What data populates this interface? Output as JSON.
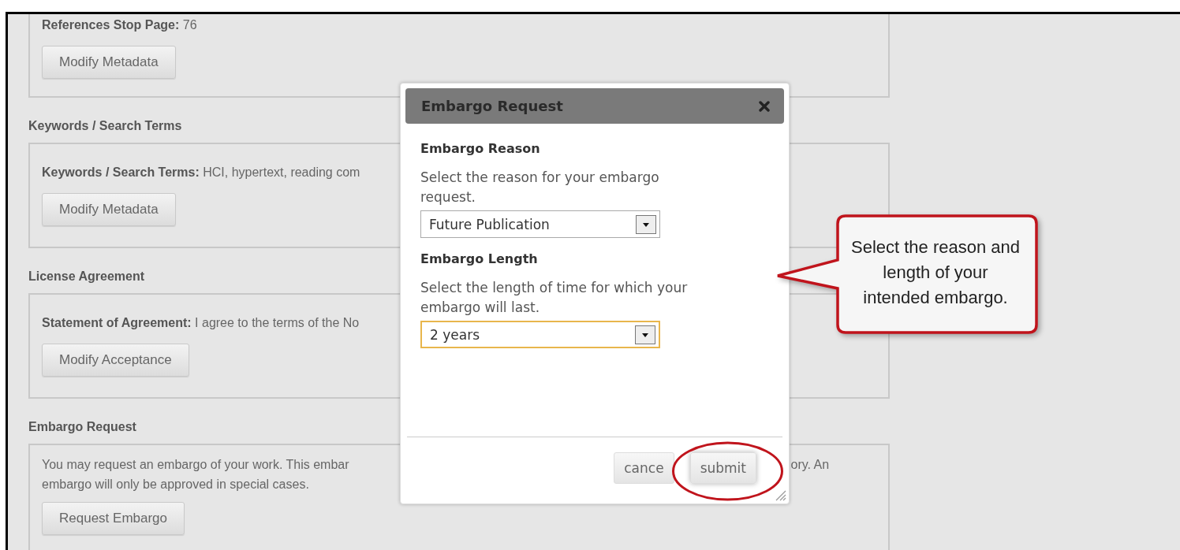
{
  "sections": [
    {
      "fields": [
        {
          "label": "References Stop Page:",
          "value": "76"
        }
      ],
      "button": "Modify Metadata",
      "top_cut": true
    },
    {
      "heading": "Keywords / Search Terms",
      "fields": [
        {
          "label": "Keywords / Search Terms:",
          "value": "HCI, hypertext, reading com"
        }
      ],
      "button": "Modify Metadata",
      "top_cut": false
    },
    {
      "heading": "License Agreement",
      "fields": [
        {
          "label": "Statement of Agreement:",
          "value": "I agree to the terms of the No"
        }
      ],
      "button": "Modify Acceptance",
      "top_cut": false
    },
    {
      "heading": "Embargo Request",
      "description": {
        "line_1_left": "You may request an embargo of your work. This embar",
        "line_1_right": "ory. An",
        "line_2": "embargo will only be approved in special cases."
      },
      "button": "Request Embargo",
      "top_cut": false
    }
  ],
  "dialog": {
    "title": "Embargo Request",
    "groups": [
      {
        "heading": "Embargo Reason",
        "hint": "Select the reason for your embargo request.",
        "value": "Future Publication",
        "focused": false
      },
      {
        "heading": "Embargo Length",
        "hint": "Select the length of time for which your embargo will last.",
        "value": "2 years",
        "focused": true
      }
    ],
    "buttons": [
      {
        "label": "cance",
        "highlighted": false
      },
      {
        "label": "submit",
        "highlighted": true
      }
    ]
  },
  "callout": {
    "text": "Select the reason and length of your intended embargo."
  }
}
